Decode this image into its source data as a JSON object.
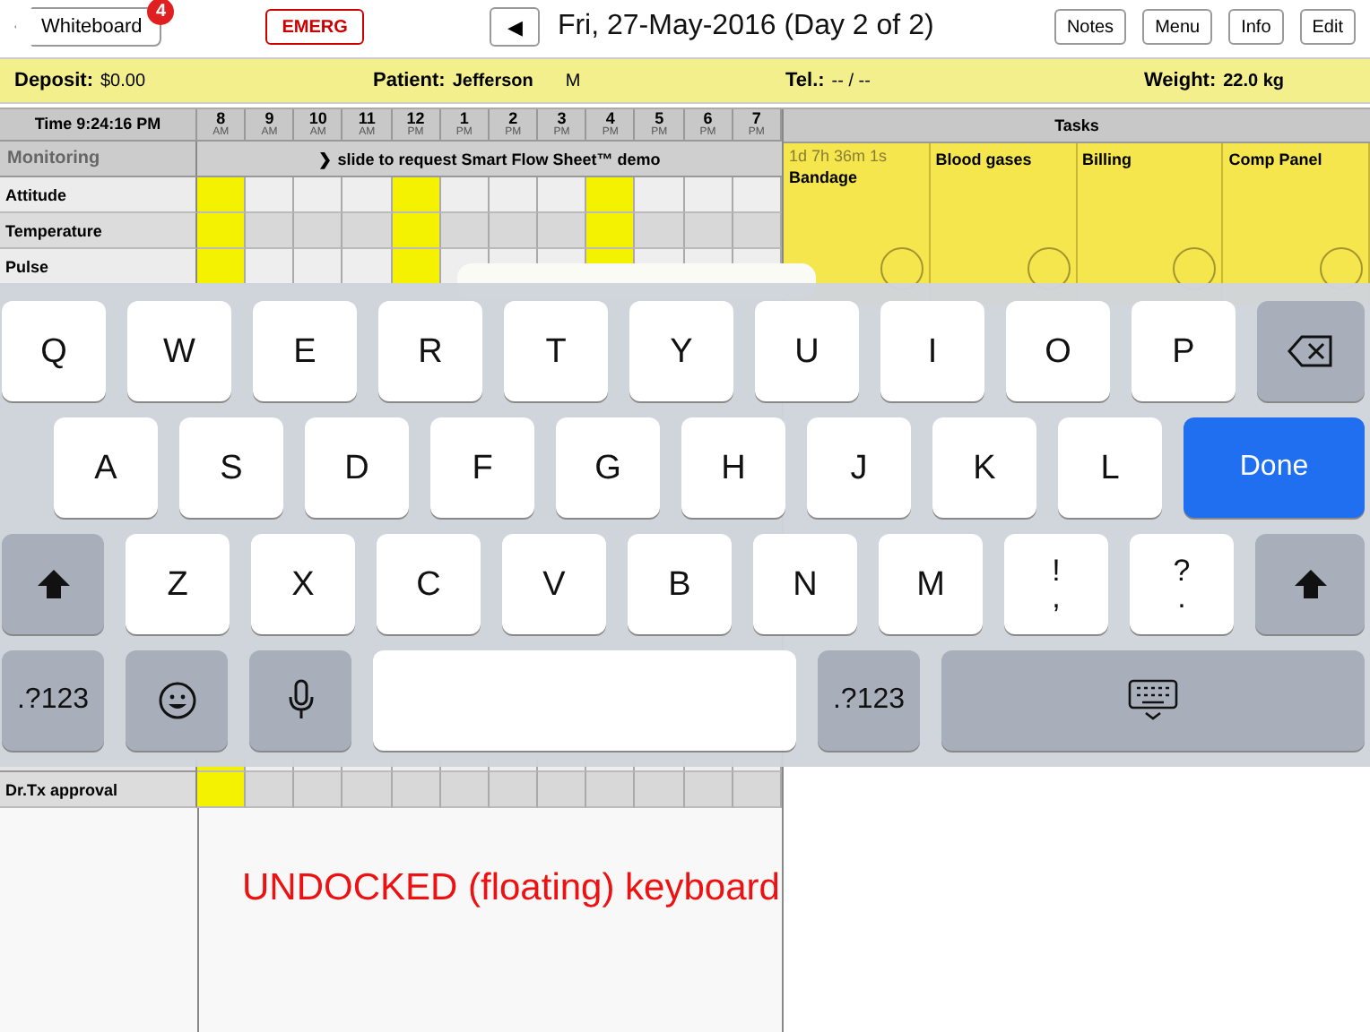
{
  "top_bar": {
    "back_button": "Whiteboard",
    "badge": "4",
    "emergency_button": "EMERG",
    "prev_button": "◀",
    "date_title": "Fri, 27-May-2016 (Day 2 of 2)",
    "buttons": [
      "Notes",
      "Menu",
      "Info",
      "Edit"
    ]
  },
  "info_bar": [
    {
      "label": "Deposit:",
      "value": "$0.00"
    },
    {
      "label": "Patient:",
      "value": "Jefferson",
      "extra": "M"
    },
    {
      "label": "Tel.:",
      "value": "-- / --"
    },
    {
      "label": "Weight:",
      "value": "22.0 kg"
    }
  ],
  "flow_sheet": {
    "time": "Time 9:24:16 PM",
    "hours": [
      {
        "hour": "8",
        "period": "AM"
      },
      {
        "hour": "9",
        "period": "AM"
      },
      {
        "hour": "10",
        "period": "AM"
      },
      {
        "hour": "11",
        "period": "AM"
      },
      {
        "hour": "12",
        "period": "PM"
      },
      {
        "hour": "1",
        "period": "PM"
      },
      {
        "hour": "2",
        "period": "PM"
      },
      {
        "hour": "3",
        "period": "PM"
      },
      {
        "hour": "4",
        "period": "PM"
      },
      {
        "hour": "5",
        "period": "PM"
      },
      {
        "hour": "6",
        "period": "PM"
      },
      {
        "hour": "7",
        "period": "PM"
      }
    ],
    "section": "Monitoring",
    "banner": "❯ slide to request Smart Flow Sheet™ demo",
    "rows": [
      {
        "label": "Attitude",
        "highlighted": [
          true,
          false,
          false,
          false,
          true,
          false,
          false,
          false,
          true,
          false,
          false,
          false
        ]
      },
      {
        "label": "Temperature",
        "highlighted": [
          true,
          false,
          false,
          false,
          true,
          false,
          false,
          false,
          true,
          false,
          false,
          false
        ]
      },
      {
        "label": "Pulse",
        "highlighted": [
          true,
          false,
          false,
          false,
          true,
          false,
          false,
          false,
          true,
          false,
          false,
          false
        ]
      }
    ],
    "bottom_rows": [
      {
        "label": "Dr.Tx approval",
        "highlighted": [
          true,
          false,
          false,
          false,
          false,
          false,
          false,
          false,
          false,
          false,
          false,
          false
        ]
      }
    ]
  },
  "tasks": {
    "title": "Tasks",
    "items": [
      {
        "timer": "1d 7h 36m 1s",
        "name": "Bandage",
        "checked": false
      },
      {
        "name": "Blood gases",
        "checked": false
      },
      {
        "name": "Billing",
        "checked": false
      },
      {
        "name": "Comp Panel",
        "checked": false
      }
    ]
  },
  "keyboard": {
    "rows": [
      [
        {
          "kind": "letter",
          "label": "Q"
        },
        {
          "kind": "letter",
          "label": "W"
        },
        {
          "kind": "letter",
          "label": "E"
        },
        {
          "kind": "letter",
          "label": "R"
        },
        {
          "kind": "letter",
          "label": "T"
        },
        {
          "kind": "letter",
          "label": "Y"
        },
        {
          "kind": "letter",
          "label": "U"
        },
        {
          "kind": "letter",
          "label": "I"
        },
        {
          "kind": "letter",
          "label": "O"
        },
        {
          "kind": "letter",
          "label": "P"
        },
        {
          "kind": "backspace"
        }
      ],
      [
        {
          "kind": "letter",
          "label": "A"
        },
        {
          "kind": "letter",
          "label": "S"
        },
        {
          "kind": "letter",
          "label": "D"
        },
        {
          "kind": "letter",
          "label": "F"
        },
        {
          "kind": "letter",
          "label": "G"
        },
        {
          "kind": "letter",
          "label": "H"
        },
        {
          "kind": "letter",
          "label": "J"
        },
        {
          "kind": "letter",
          "label": "K"
        },
        {
          "kind": "letter",
          "label": "L"
        },
        {
          "kind": "done",
          "label": "Done"
        }
      ],
      [
        {
          "kind": "shift"
        },
        {
          "kind": "letter",
          "label": "Z"
        },
        {
          "kind": "letter",
          "label": "X"
        },
        {
          "kind": "letter",
          "label": "C"
        },
        {
          "kind": "letter",
          "label": "V"
        },
        {
          "kind": "letter",
          "label": "B"
        },
        {
          "kind": "letter",
          "label": "N"
        },
        {
          "kind": "letter",
          "label": "M"
        },
        {
          "kind": "dual",
          "top": "!",
          "bottom": ","
        },
        {
          "kind": "dual",
          "top": "?",
          "bottom": "."
        },
        {
          "kind": "shift"
        }
      ],
      [
        {
          "kind": "mode",
          "label": ".?123"
        },
        {
          "kind": "emoji"
        },
        {
          "kind": "mic"
        },
        {
          "kind": "space"
        },
        {
          "kind": "mode",
          "label": ".?123"
        },
        {
          "kind": "hide"
        }
      ]
    ]
  },
  "caption": "UNDOCKED (floating) keyboard"
}
